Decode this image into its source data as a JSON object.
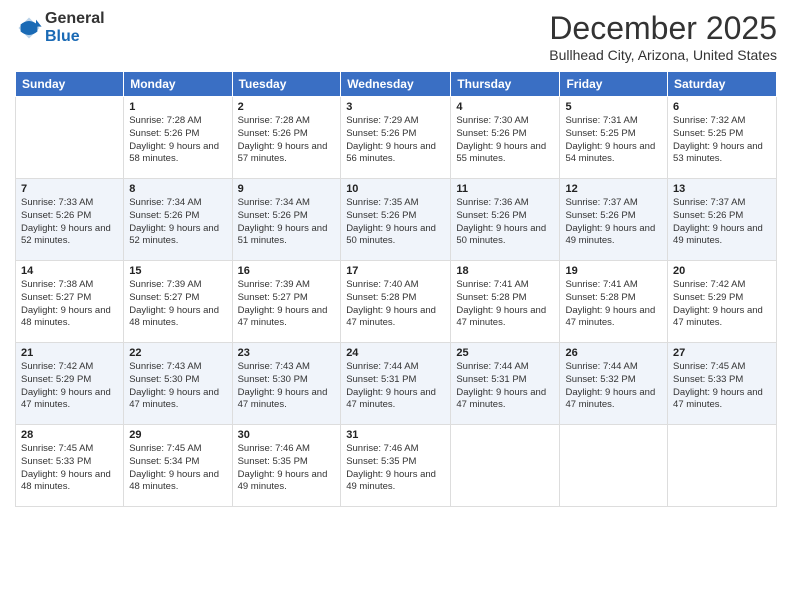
{
  "logo": {
    "general": "General",
    "blue": "Blue"
  },
  "title": "December 2025",
  "location": "Bullhead City, Arizona, United States",
  "days_of_week": [
    "Sunday",
    "Monday",
    "Tuesday",
    "Wednesday",
    "Thursday",
    "Friday",
    "Saturday"
  ],
  "weeks": [
    [
      {
        "day": "",
        "sunrise": "",
        "sunset": "",
        "daylight": ""
      },
      {
        "day": "1",
        "sunrise": "Sunrise: 7:28 AM",
        "sunset": "Sunset: 5:26 PM",
        "daylight": "Daylight: 9 hours and 58 minutes."
      },
      {
        "day": "2",
        "sunrise": "Sunrise: 7:28 AM",
        "sunset": "Sunset: 5:26 PM",
        "daylight": "Daylight: 9 hours and 57 minutes."
      },
      {
        "day": "3",
        "sunrise": "Sunrise: 7:29 AM",
        "sunset": "Sunset: 5:26 PM",
        "daylight": "Daylight: 9 hours and 56 minutes."
      },
      {
        "day": "4",
        "sunrise": "Sunrise: 7:30 AM",
        "sunset": "Sunset: 5:26 PM",
        "daylight": "Daylight: 9 hours and 55 minutes."
      },
      {
        "day": "5",
        "sunrise": "Sunrise: 7:31 AM",
        "sunset": "Sunset: 5:25 PM",
        "daylight": "Daylight: 9 hours and 54 minutes."
      },
      {
        "day": "6",
        "sunrise": "Sunrise: 7:32 AM",
        "sunset": "Sunset: 5:25 PM",
        "daylight": "Daylight: 9 hours and 53 minutes."
      }
    ],
    [
      {
        "day": "7",
        "sunrise": "Sunrise: 7:33 AM",
        "sunset": "Sunset: 5:26 PM",
        "daylight": "Daylight: 9 hours and 52 minutes."
      },
      {
        "day": "8",
        "sunrise": "Sunrise: 7:34 AM",
        "sunset": "Sunset: 5:26 PM",
        "daylight": "Daylight: 9 hours and 52 minutes."
      },
      {
        "day": "9",
        "sunrise": "Sunrise: 7:34 AM",
        "sunset": "Sunset: 5:26 PM",
        "daylight": "Daylight: 9 hours and 51 minutes."
      },
      {
        "day": "10",
        "sunrise": "Sunrise: 7:35 AM",
        "sunset": "Sunset: 5:26 PM",
        "daylight": "Daylight: 9 hours and 50 minutes."
      },
      {
        "day": "11",
        "sunrise": "Sunrise: 7:36 AM",
        "sunset": "Sunset: 5:26 PM",
        "daylight": "Daylight: 9 hours and 50 minutes."
      },
      {
        "day": "12",
        "sunrise": "Sunrise: 7:37 AM",
        "sunset": "Sunset: 5:26 PM",
        "daylight": "Daylight: 9 hours and 49 minutes."
      },
      {
        "day": "13",
        "sunrise": "Sunrise: 7:37 AM",
        "sunset": "Sunset: 5:26 PM",
        "daylight": "Daylight: 9 hours and 49 minutes."
      }
    ],
    [
      {
        "day": "14",
        "sunrise": "Sunrise: 7:38 AM",
        "sunset": "Sunset: 5:27 PM",
        "daylight": "Daylight: 9 hours and 48 minutes."
      },
      {
        "day": "15",
        "sunrise": "Sunrise: 7:39 AM",
        "sunset": "Sunset: 5:27 PM",
        "daylight": "Daylight: 9 hours and 48 minutes."
      },
      {
        "day": "16",
        "sunrise": "Sunrise: 7:39 AM",
        "sunset": "Sunset: 5:27 PM",
        "daylight": "Daylight: 9 hours and 47 minutes."
      },
      {
        "day": "17",
        "sunrise": "Sunrise: 7:40 AM",
        "sunset": "Sunset: 5:28 PM",
        "daylight": "Daylight: 9 hours and 47 minutes."
      },
      {
        "day": "18",
        "sunrise": "Sunrise: 7:41 AM",
        "sunset": "Sunset: 5:28 PM",
        "daylight": "Daylight: 9 hours and 47 minutes."
      },
      {
        "day": "19",
        "sunrise": "Sunrise: 7:41 AM",
        "sunset": "Sunset: 5:28 PM",
        "daylight": "Daylight: 9 hours and 47 minutes."
      },
      {
        "day": "20",
        "sunrise": "Sunrise: 7:42 AM",
        "sunset": "Sunset: 5:29 PM",
        "daylight": "Daylight: 9 hours and 47 minutes."
      }
    ],
    [
      {
        "day": "21",
        "sunrise": "Sunrise: 7:42 AM",
        "sunset": "Sunset: 5:29 PM",
        "daylight": "Daylight: 9 hours and 47 minutes."
      },
      {
        "day": "22",
        "sunrise": "Sunrise: 7:43 AM",
        "sunset": "Sunset: 5:30 PM",
        "daylight": "Daylight: 9 hours and 47 minutes."
      },
      {
        "day": "23",
        "sunrise": "Sunrise: 7:43 AM",
        "sunset": "Sunset: 5:30 PM",
        "daylight": "Daylight: 9 hours and 47 minutes."
      },
      {
        "day": "24",
        "sunrise": "Sunrise: 7:44 AM",
        "sunset": "Sunset: 5:31 PM",
        "daylight": "Daylight: 9 hours and 47 minutes."
      },
      {
        "day": "25",
        "sunrise": "Sunrise: 7:44 AM",
        "sunset": "Sunset: 5:31 PM",
        "daylight": "Daylight: 9 hours and 47 minutes."
      },
      {
        "day": "26",
        "sunrise": "Sunrise: 7:44 AM",
        "sunset": "Sunset: 5:32 PM",
        "daylight": "Daylight: 9 hours and 47 minutes."
      },
      {
        "day": "27",
        "sunrise": "Sunrise: 7:45 AM",
        "sunset": "Sunset: 5:33 PM",
        "daylight": "Daylight: 9 hours and 47 minutes."
      }
    ],
    [
      {
        "day": "28",
        "sunrise": "Sunrise: 7:45 AM",
        "sunset": "Sunset: 5:33 PM",
        "daylight": "Daylight: 9 hours and 48 minutes."
      },
      {
        "day": "29",
        "sunrise": "Sunrise: 7:45 AM",
        "sunset": "Sunset: 5:34 PM",
        "daylight": "Daylight: 9 hours and 48 minutes."
      },
      {
        "day": "30",
        "sunrise": "Sunrise: 7:46 AM",
        "sunset": "Sunset: 5:35 PM",
        "daylight": "Daylight: 9 hours and 49 minutes."
      },
      {
        "day": "31",
        "sunrise": "Sunrise: 7:46 AM",
        "sunset": "Sunset: 5:35 PM",
        "daylight": "Daylight: 9 hours and 49 minutes."
      },
      {
        "day": "",
        "sunrise": "",
        "sunset": "",
        "daylight": ""
      },
      {
        "day": "",
        "sunrise": "",
        "sunset": "",
        "daylight": ""
      },
      {
        "day": "",
        "sunrise": "",
        "sunset": "",
        "daylight": ""
      }
    ]
  ]
}
